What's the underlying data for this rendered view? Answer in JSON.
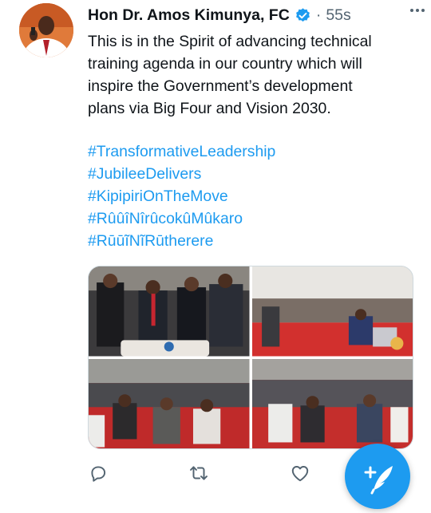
{
  "tweet": {
    "author_name": "Hon Dr. Amos Kimunya, FC",
    "separator": "·",
    "time_ago": "55s",
    "text": "This is in the Spirit of advancing technical\ntraining agenda in our country which will\ninspire the Government’s development\nplans via Big Four and Vision 2030.",
    "hashtags": [
      "#TransformativeLeadership",
      "#JubileeDelivers",
      "#KipipiriOnTheMove",
      "#RûûîNîrûcokûMûkaro",
      "#RūūĩNĩRūtherere"
    ],
    "media_count": 4
  },
  "actions": {
    "icons": [
      "reply-icon",
      "retweet-icon",
      "like-icon",
      "share-icon"
    ]
  },
  "compose": {
    "icon": "compose-feather-icon"
  },
  "colors": {
    "accent": "#1d9bf0",
    "text": "#0f1419",
    "muted": "#536471"
  }
}
